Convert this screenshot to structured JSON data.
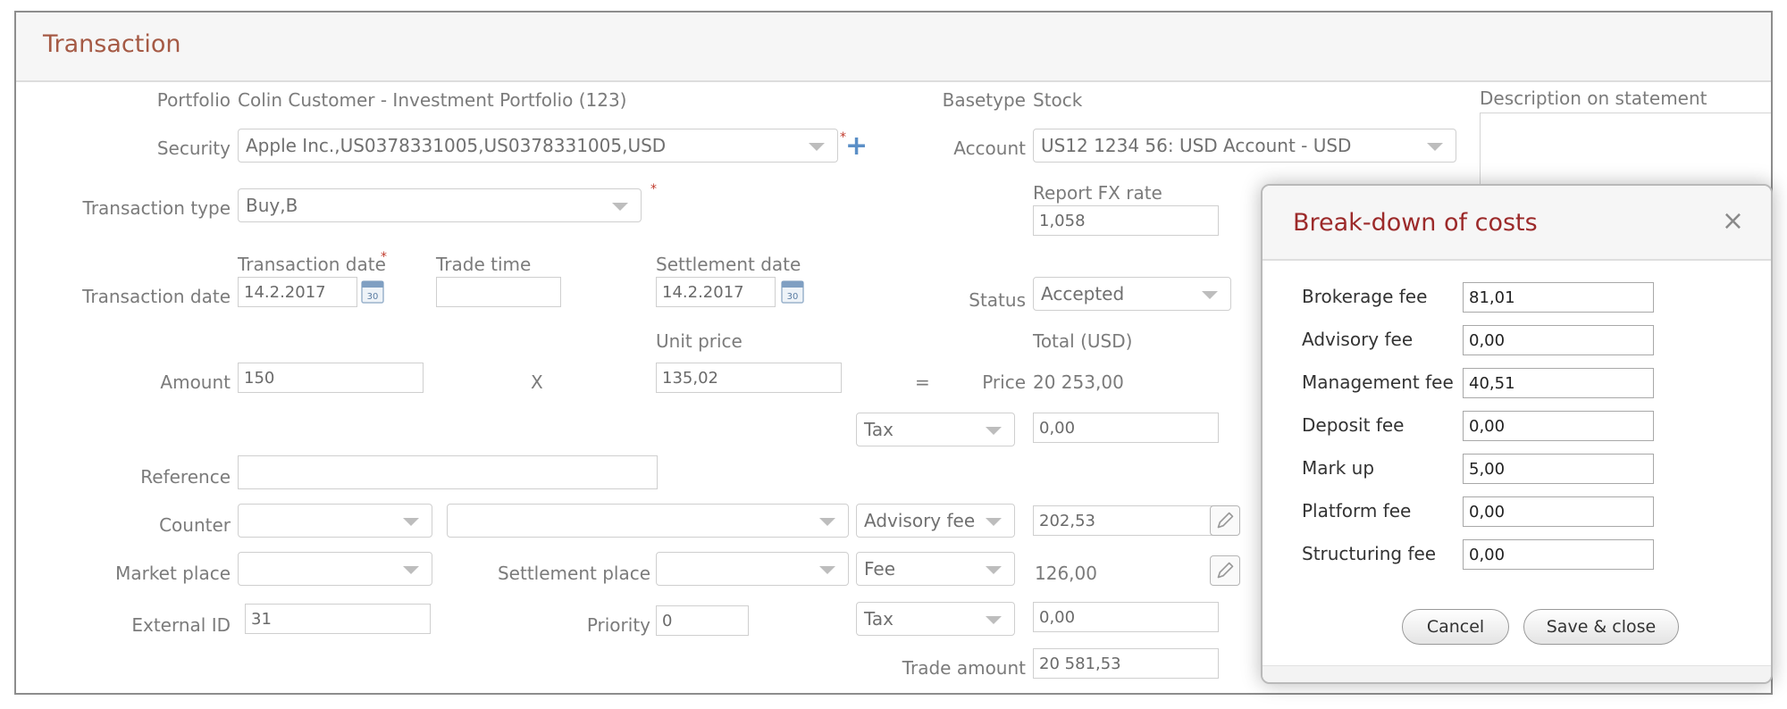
{
  "window": {
    "title": "Transaction"
  },
  "form": {
    "portfolio_label": "Portfolio",
    "portfolio_value": "Colin Customer - Investment Portfolio (123)",
    "basetype_label": "Basetype",
    "basetype_value": "Stock",
    "description_label": "Description on statement",
    "security_label": "Security",
    "security_value": "Apple Inc.,US0378331005,US0378331005,USD",
    "account_label": "Account",
    "account_value": "US12 1234 56: USD Account - USD",
    "transaction_type_label": "Transaction type",
    "transaction_type_value": "Buy,B",
    "report_fx_label": "Report FX rate",
    "report_fx_value": "1,058",
    "transaction_date_row_label": "Transaction date",
    "transaction_date_label": "Transaction date",
    "transaction_date_value": "14.2.2017",
    "trade_time_label": "Trade time",
    "trade_time_value": "",
    "settlement_date_label": "Settlement date",
    "settlement_date_value": "14.2.2017",
    "status_label": "Status",
    "status_value": "Accepted",
    "unit_price_label": "Unit price",
    "total_label": "Total (USD)",
    "amount_label": "Amount",
    "amount_value": "150",
    "multiply_symbol": "X",
    "unit_price_value": "135,02",
    "equals_symbol": "=",
    "price_label": "Price",
    "price_value": "20 253,00",
    "tax_select_1": "Tax",
    "tax_value_1": "0,00",
    "reference_label": "Reference",
    "reference_value": "",
    "counter_label": "Counter",
    "counter_value_1": "",
    "counter_value_2": "",
    "advisory_select": "Advisory fee",
    "advisory_value": "202,53",
    "market_place_label": "Market place",
    "market_place_value": "",
    "settlement_place_label": "Settlement place",
    "settlement_place_value": "",
    "fee_select": "Fee",
    "fee_value": "126,00",
    "external_id_label": "External ID",
    "external_id_value": "31",
    "priority_label": "Priority",
    "priority_value": "0",
    "tax_select_2": "Tax",
    "tax_value_2": "0,00",
    "trade_amount_label": "Trade amount",
    "trade_amount_value": "20 581,53",
    "required_mark": "*",
    "add_symbol": "+",
    "calendar_day": "30"
  },
  "modal": {
    "title": "Break-down of costs",
    "close_symbol": "×",
    "fees": [
      {
        "label": "Brokerage fee",
        "value": "81,01"
      },
      {
        "label": "Advisory fee",
        "value": "0,00"
      },
      {
        "label": "Management fee",
        "value": "40,51"
      },
      {
        "label": "Deposit fee",
        "value": "0,00"
      },
      {
        "label": "Mark up",
        "value": "5,00"
      },
      {
        "label": "Platform fee",
        "value": "0,00"
      },
      {
        "label": "Structuring fee",
        "value": "0,00"
      }
    ],
    "cancel_label": "Cancel",
    "save_label": "Save & close"
  },
  "colors": {
    "title": "#a55a45",
    "modal_title": "#9c2a2a",
    "add_icon": "#5b8fc7"
  }
}
